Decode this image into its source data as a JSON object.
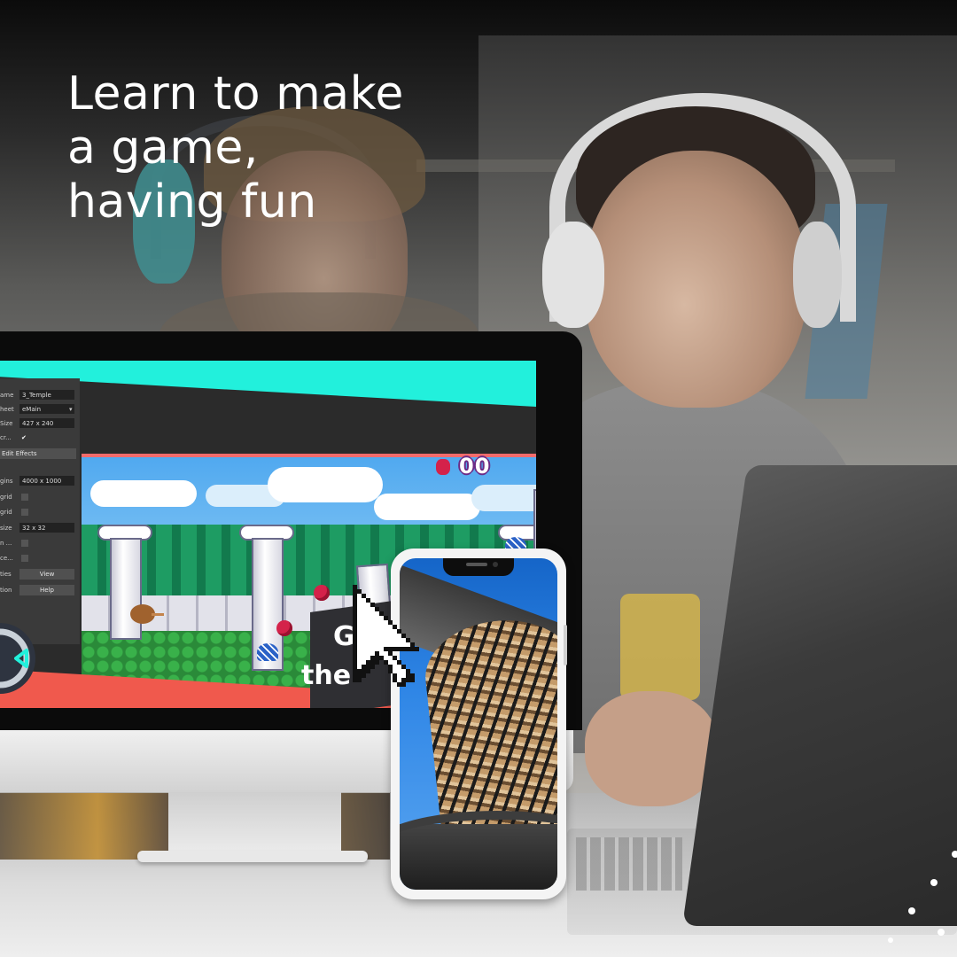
{
  "headline": {
    "line1": "Learn to make",
    "line2": "a game,",
    "line3": "having fun"
  },
  "editor_panel": {
    "rows": [
      {
        "label": "ame",
        "value": "3_Temple",
        "type": "field"
      },
      {
        "label": "heet",
        "value": "eMain",
        "type": "select"
      },
      {
        "label": "Size",
        "value": "427 x 240",
        "type": "field"
      },
      {
        "label": "cr...",
        "value": "✔",
        "type": "check"
      },
      {
        "label": "gins",
        "value": "4000 x 1000",
        "type": "field"
      },
      {
        "label": "grid",
        "value": "",
        "type": "check"
      },
      {
        "label": "grid",
        "value": "",
        "type": "check"
      },
      {
        "label": "size",
        "value": "32 x 32",
        "type": "field"
      },
      {
        "label": "n ...",
        "value": "",
        "type": "check"
      },
      {
        "label": "ce...",
        "value": "",
        "type": "check"
      }
    ],
    "edit_effects_label": "Edit Effects",
    "bottom_buttons": [
      {
        "label_prefix": "ties",
        "button": "View"
      },
      {
        "label_prefix": "tion",
        "button": "Help"
      }
    ]
  },
  "game": {
    "score": "00",
    "banner_line1": "G",
    "banner_line2": "the"
  },
  "colors": {
    "accent_cyan": "#22f0dc",
    "accent_red": "#f0594d",
    "headline_text": "#ffffff"
  },
  "icons": [
    "construct-logo-icon",
    "pixel-cursor-icon",
    "ladybug-score-icon"
  ]
}
